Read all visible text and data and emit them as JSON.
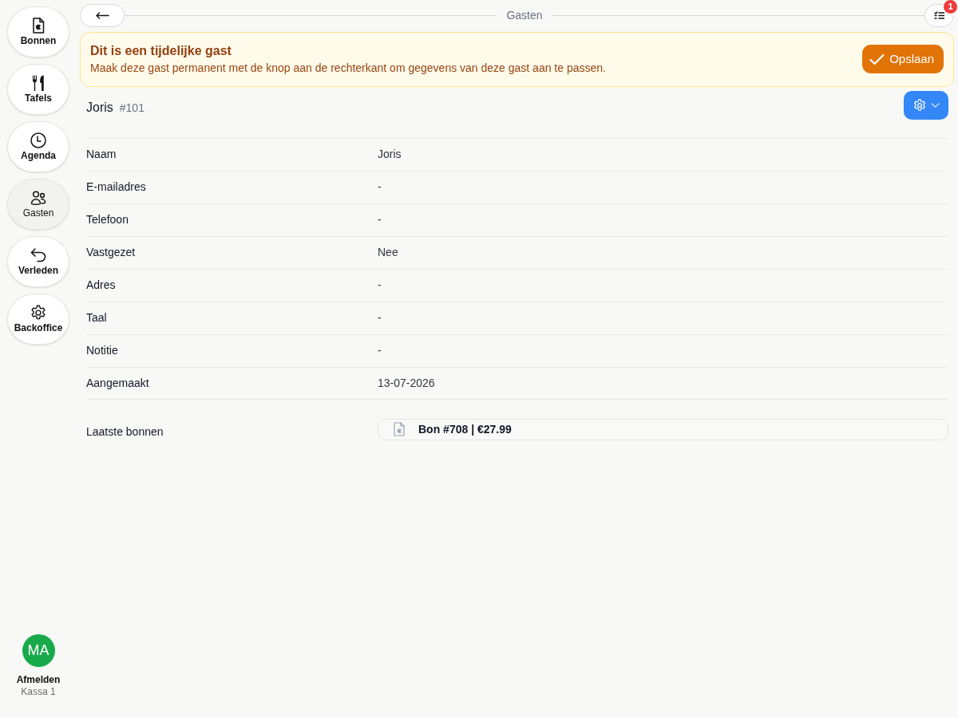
{
  "sidebar": {
    "items": [
      {
        "label": "Bonnen",
        "selected": false
      },
      {
        "label": "Tafels",
        "selected": false
      },
      {
        "label": "Agenda",
        "selected": false
      },
      {
        "label": "Gasten",
        "selected": true
      },
      {
        "label": "Verleden",
        "selected": false
      },
      {
        "label": "Backoffice",
        "selected": false
      }
    ],
    "user": {
      "initials": "MA",
      "action": "Afmelden",
      "register": "Kassa 1"
    }
  },
  "header": {
    "title": "Gasten",
    "notification_count": "1"
  },
  "alert": {
    "title": "Dit is een tijdelijke gast",
    "message": "Maak deze gast permanent met de knop aan de rechterkant om gegevens van deze gast aan te passen.",
    "button": "Opslaan"
  },
  "guest": {
    "name": "Joris",
    "number": "#101"
  },
  "fields": [
    {
      "label": "Naam",
      "value": "Joris"
    },
    {
      "label": "E-mailadres",
      "value": "-"
    },
    {
      "label": "Telefoon",
      "value": "-"
    },
    {
      "label": "Vastgezet",
      "value": "Nee"
    },
    {
      "label": "Adres",
      "value": "-"
    },
    {
      "label": "Taal",
      "value": "-"
    },
    {
      "label": "Notitie",
      "value": "-"
    },
    {
      "label": "Aangemaakt",
      "value": "13-07-2026"
    }
  ],
  "recent_receipts": {
    "label": "Laatste bonnen",
    "items": [
      "Bon #708 | €27.99"
    ]
  }
}
